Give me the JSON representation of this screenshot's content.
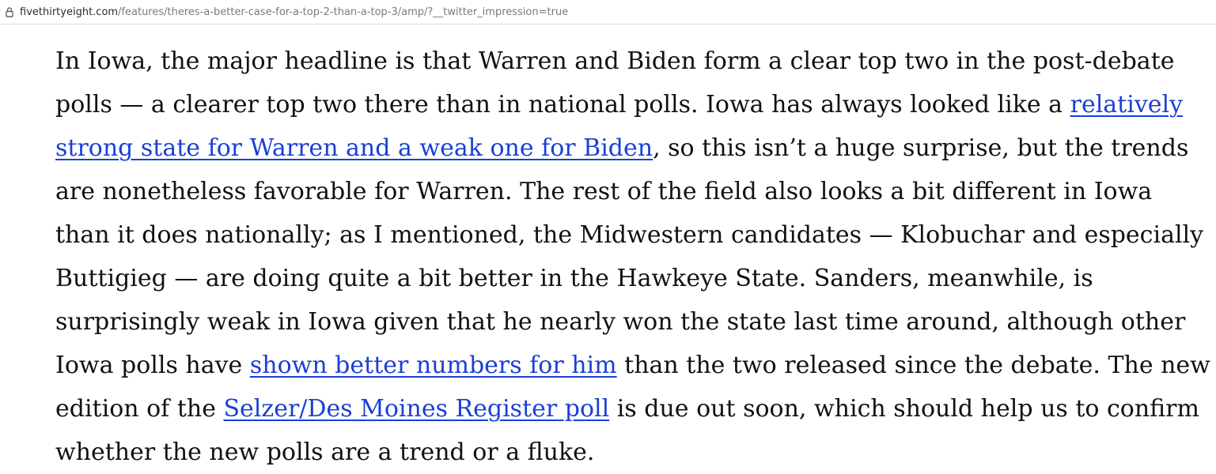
{
  "address_bar": {
    "lock_icon": "lock-icon",
    "domain": "fivethirtyeight.com",
    "path": "/features/theres-a-better-case-for-a-top-2-than-a-top-3/amp/?__twitter_impression=true"
  },
  "article": {
    "text_1": "In Iowa, the major headline is that Warren and Biden form a clear top two in the post-debate polls — a clearer top two there than in national polls. Iowa has always looked like a ",
    "link_1": "relatively strong state for Warren and a weak one for Biden",
    "text_2": ", so this isn’t a huge surprise, but the trends are nonetheless favorable for Warren. The rest of the field also looks a bit different in Iowa than it does nationally; as I mentioned, the Midwestern candidates — Klobuchar and especially Buttigieg — are doing quite a bit better in the Hawkeye State. Sanders, meanwhile, is surprisingly weak in Iowa given that he nearly won the state last time around, although other Iowa polls have ",
    "link_2": "shown better numbers for him",
    "text_3": " than the two released since the debate. The new edition of the ",
    "link_3": "Selzer/Des Moines Register poll",
    "text_4": " is due out soon, which should help us to confirm whether the new polls are a trend or a fluke."
  },
  "colors": {
    "link": "#1a3fd6",
    "text": "#111111",
    "url_muted": "#7a7a7a"
  }
}
